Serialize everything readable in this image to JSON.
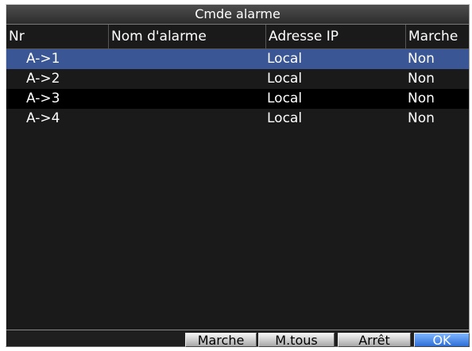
{
  "window": {
    "title": "Cmde alarme"
  },
  "table": {
    "columns": [
      "Nr",
      "Nom d'alarme",
      "Adresse IP",
      "Marche"
    ],
    "rows": [
      {
        "nr": "A->1",
        "name": "",
        "ip": "Local",
        "marche": "Non"
      },
      {
        "nr": "A->2",
        "name": "",
        "ip": "Local",
        "marche": "Non"
      },
      {
        "nr": "A->3",
        "name": "",
        "ip": "Local",
        "marche": "Non"
      },
      {
        "nr": "A->4",
        "name": "",
        "ip": "Local",
        "marche": "Non"
      }
    ],
    "selected_row": 0
  },
  "buttons": {
    "marche": "Marche",
    "mtous": "M.tous",
    "arret": "Arrêt",
    "ok": "OK"
  },
  "colors": {
    "background": "#1a1a1a",
    "selected_row": "#3a5694",
    "focused_button": "#2f6fd6"
  }
}
